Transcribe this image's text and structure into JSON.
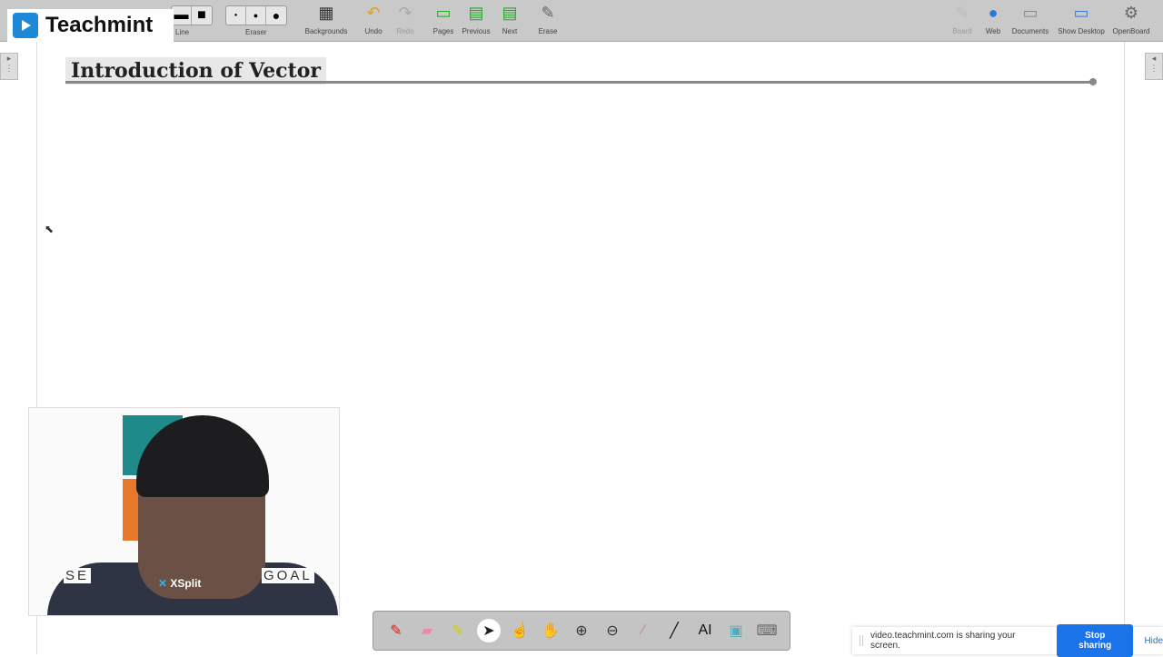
{
  "app": {
    "logo_text": "Teachmint"
  },
  "toolbar": {
    "line_label": "Line",
    "eraser_label": "Eraser",
    "items": [
      {
        "label": "Backgrounds",
        "icon": "backgrounds-icon",
        "disabled": false
      },
      {
        "label": "Undo",
        "icon": "undo-icon",
        "disabled": false
      },
      {
        "label": "Redo",
        "icon": "redo-icon",
        "disabled": true
      },
      {
        "label": "Pages",
        "icon": "pages-icon",
        "disabled": false
      },
      {
        "label": "Previous",
        "icon": "previous-page-icon",
        "disabled": false
      },
      {
        "label": "Next",
        "icon": "next-page-icon",
        "disabled": false
      },
      {
        "label": "Erase",
        "icon": "erase-all-icon",
        "disabled": false
      }
    ],
    "right_items": [
      {
        "label": "Board",
        "icon": "board-icon",
        "disabled": true
      },
      {
        "label": "Web",
        "icon": "globe-icon",
        "disabled": false
      },
      {
        "label": "Documents",
        "icon": "folder-icon",
        "disabled": false
      },
      {
        "label": "Show Desktop",
        "icon": "desktop-icon",
        "disabled": false
      },
      {
        "label": "OpenBoard",
        "icon": "gear-icon",
        "disabled": false
      }
    ]
  },
  "board": {
    "title": "Introduction of Vector"
  },
  "webcam": {
    "backdrop_left": "SE",
    "backdrop_right": "GOAL",
    "watermark": "XSplit"
  },
  "bottom_tools": [
    "pen-icon",
    "eraser-icon",
    "highlighter-icon",
    "pointer-icon",
    "hand-pointer-icon",
    "hand-pan-icon",
    "zoom-in-icon",
    "zoom-out-icon",
    "laser-pointer-icon",
    "line-icon",
    "text-icon",
    "capture-icon",
    "keyboard-icon"
  ],
  "share_bar": {
    "message": "video.teachmint.com is sharing your screen.",
    "stop_label": "Stop sharing",
    "hide_label": "Hide"
  },
  "colors": {
    "accent": "#1a73e8",
    "toolbar_bg": "#c9c9c9",
    "logo": "#1e88d8"
  }
}
